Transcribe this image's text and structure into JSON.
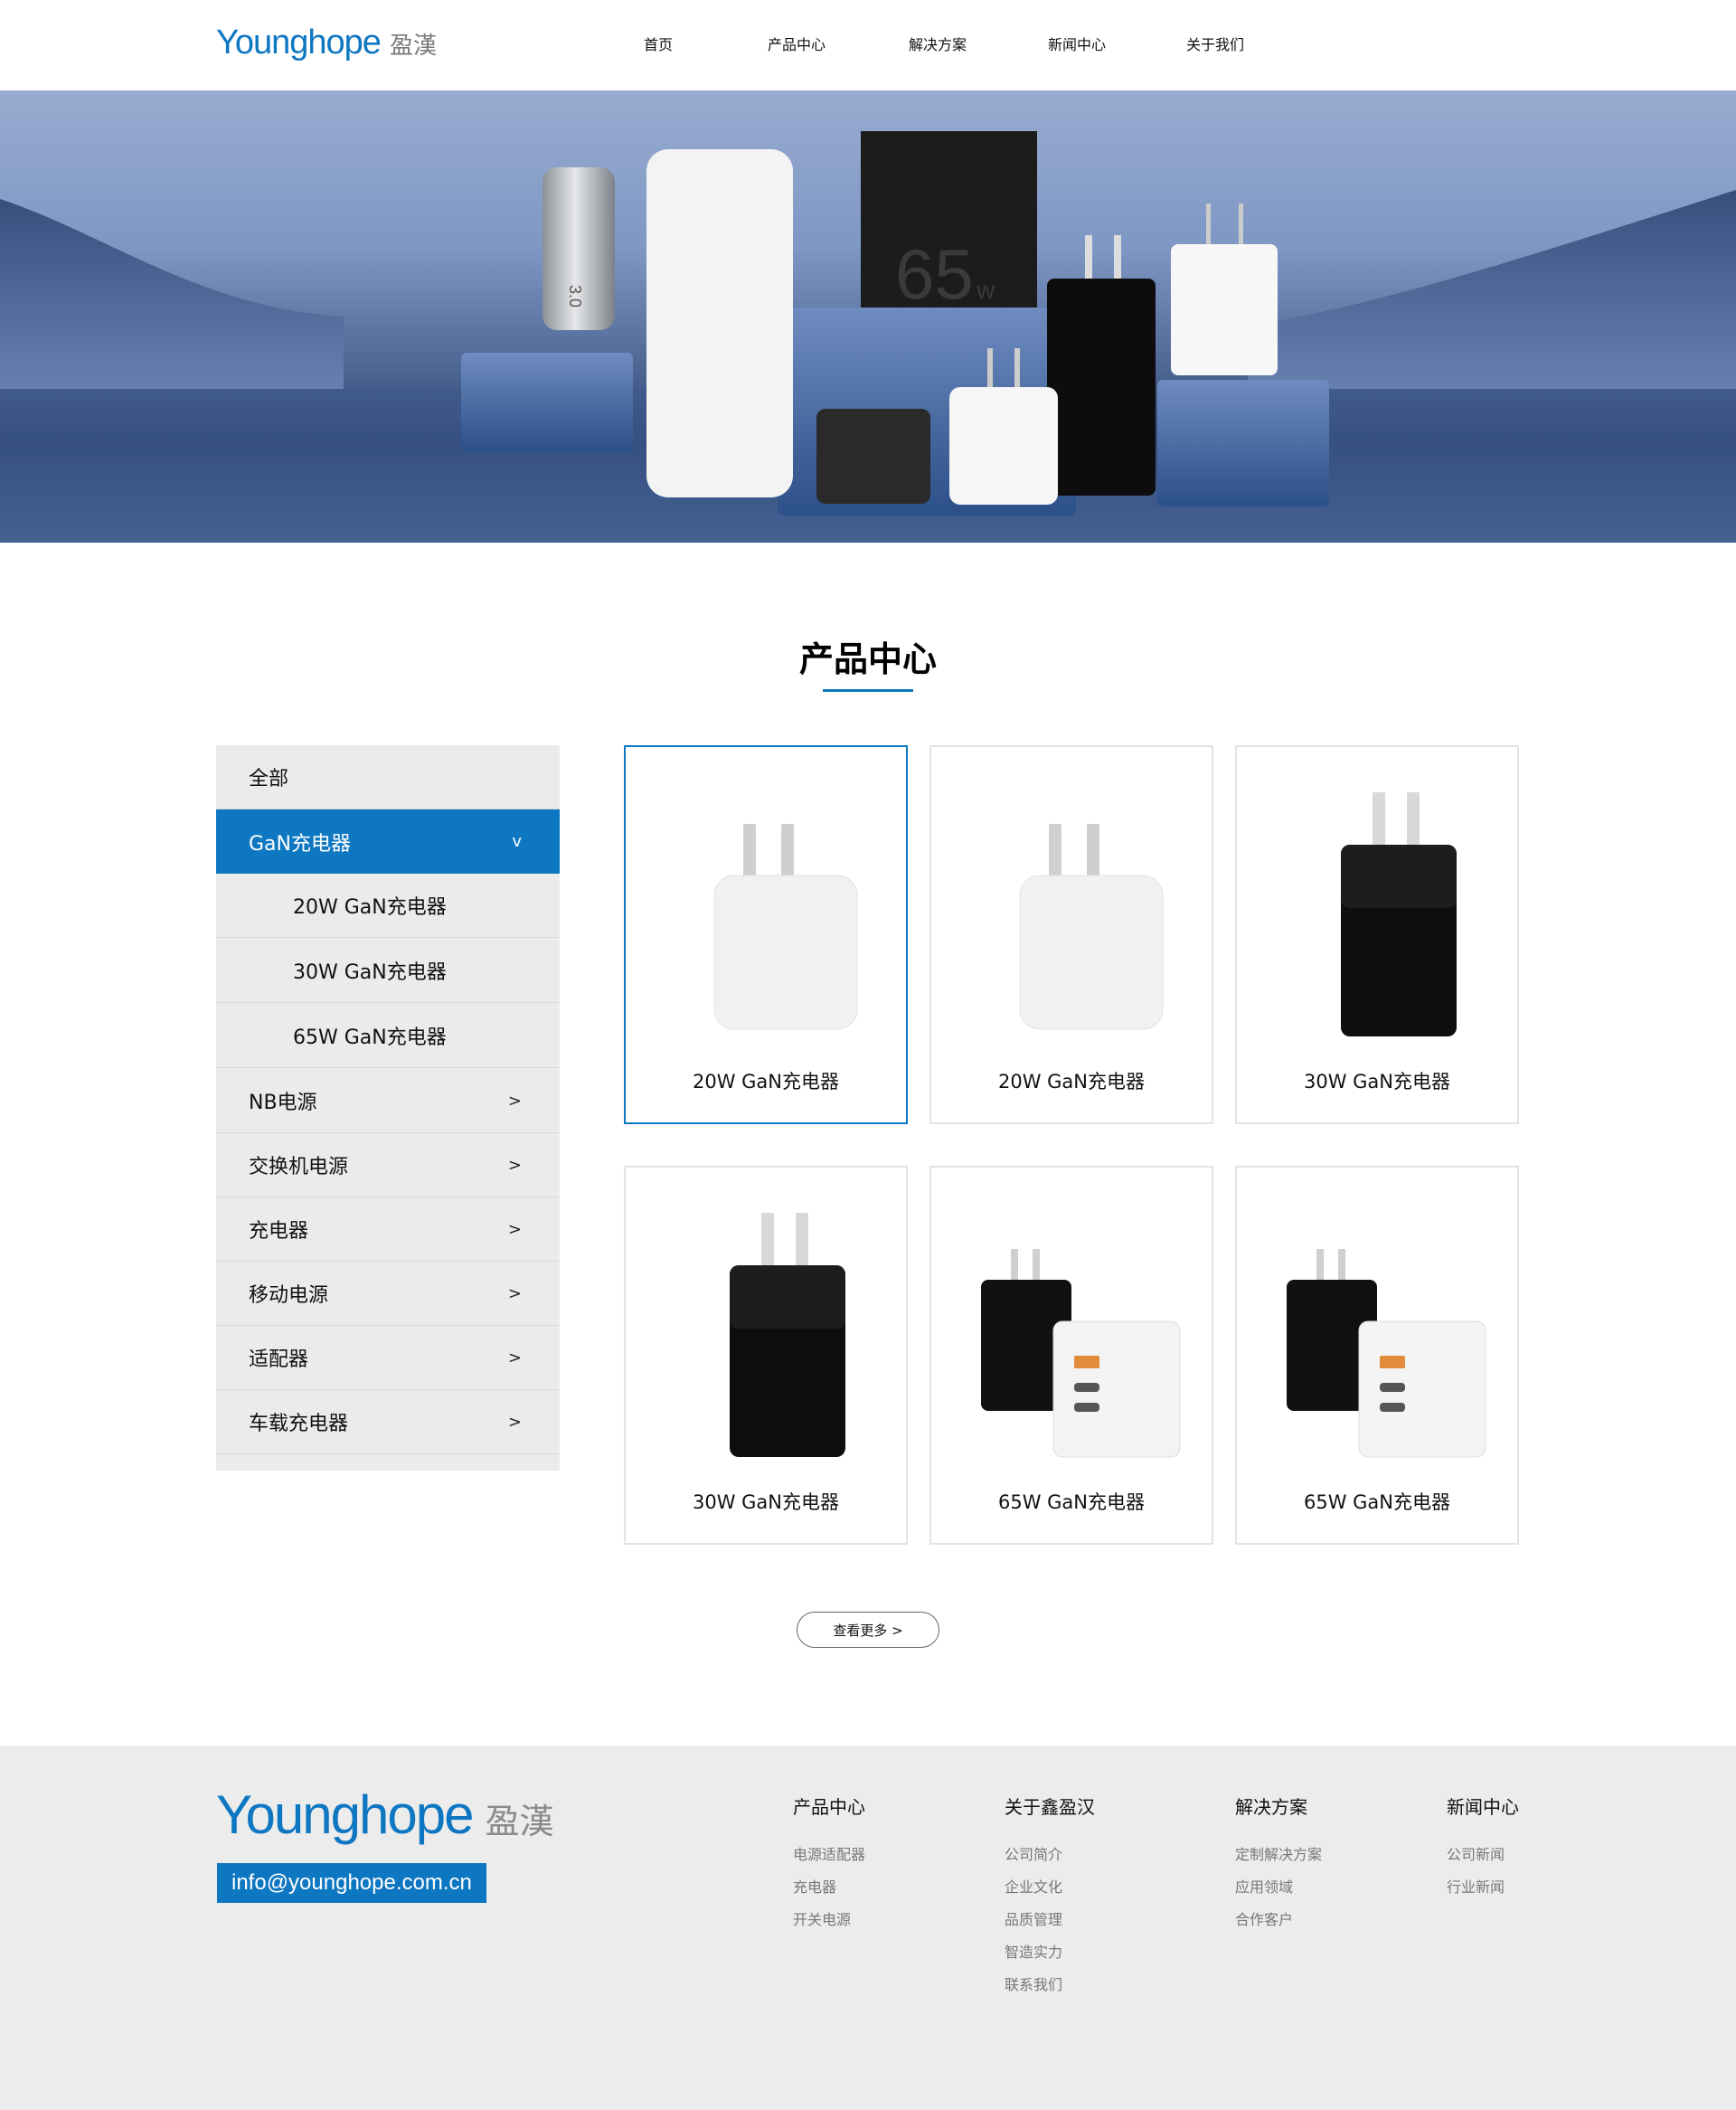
{
  "header": {
    "logo_en": "Younghope",
    "logo_cn": "盈漢",
    "nav": [
      "首页",
      "产品中心",
      "解决方案",
      "新闻中心",
      "关于我们"
    ]
  },
  "banner": {
    "power_label": "65",
    "power_unit": "w",
    "car_charger_text": "3.0"
  },
  "section": {
    "title": "产品中心"
  },
  "sidebar": {
    "items": [
      {
        "label": "全部",
        "arrow": ""
      },
      {
        "label": "GaN充电器",
        "arrow": "v"
      },
      {
        "label": "20W GaN充电器",
        "arrow": ""
      },
      {
        "label": "30W GaN充电器",
        "arrow": ""
      },
      {
        "label": "65W GaN充电器",
        "arrow": ""
      },
      {
        "label": "NB电源",
        "arrow": ">"
      },
      {
        "label": "交换机电源",
        "arrow": ">"
      },
      {
        "label": "充电器",
        "arrow": ">"
      },
      {
        "label": "移动电源",
        "arrow": ">"
      },
      {
        "label": "适配器",
        "arrow": ">"
      },
      {
        "label": "车载充电器",
        "arrow": ">"
      }
    ]
  },
  "products": [
    {
      "name": "20W GaN充电器"
    },
    {
      "name": "20W GaN充电器"
    },
    {
      "name": "30W GaN充电器"
    },
    {
      "name": "30W GaN充电器"
    },
    {
      "name": "65W GaN充电器"
    },
    {
      "name": "65W GaN充电器"
    }
  ],
  "more_button": "查看更多 >",
  "footer": {
    "logo_en": "Younghope",
    "logo_cn": "盈漢",
    "email": "info@younghope.com.cn",
    "columns": [
      {
        "title": "产品中心",
        "links": [
          "电源适配器",
          "充电器",
          "开关电源"
        ]
      },
      {
        "title": "关于鑫盈汉",
        "links": [
          "公司简介",
          "企业文化",
          "品质管理",
          "智造实力",
          "联系我们"
        ]
      },
      {
        "title": "解决方案",
        "links": [
          "定制解决方案",
          "应用领域",
          "合作客户"
        ]
      },
      {
        "title": "新闻中心",
        "links": [
          "公司新闻",
          "行业新闻"
        ]
      }
    ]
  },
  "colors": {
    "brand_blue": "#0e77c2",
    "sidebar_bg": "#ebebeb",
    "footer_bg": "#ececec"
  }
}
